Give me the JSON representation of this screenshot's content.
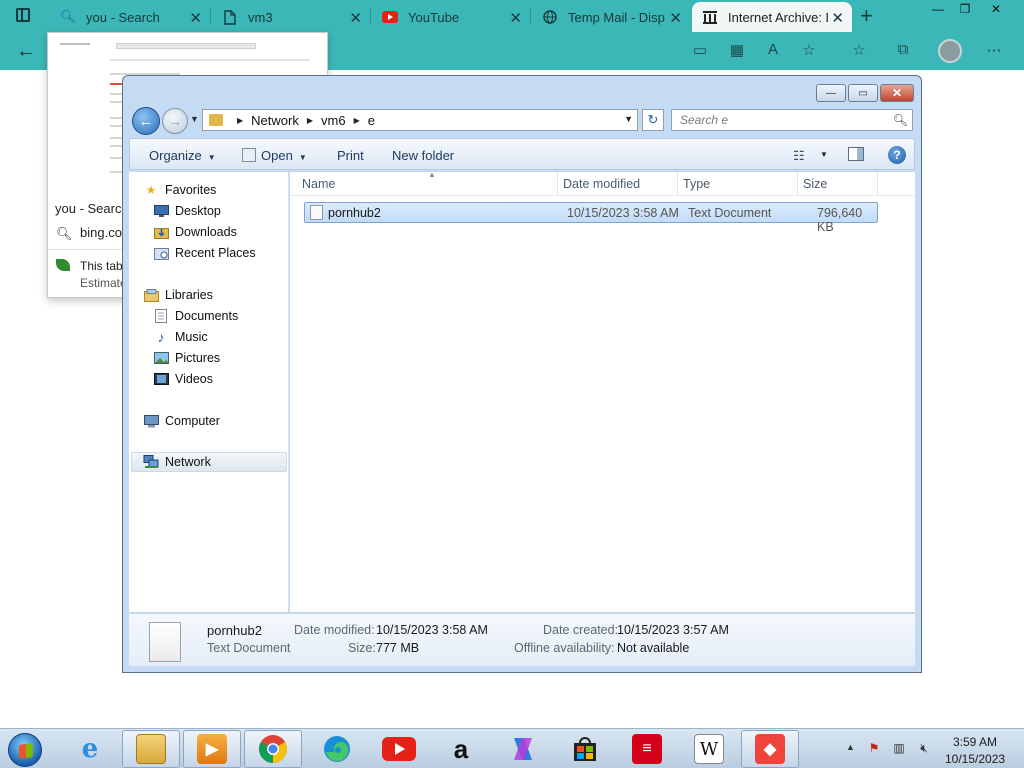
{
  "browser": {
    "tabs": [
      {
        "title": "you - Search",
        "icon": "search-icon"
      },
      {
        "title": "vm3",
        "icon": "page-icon"
      },
      {
        "title": "YouTube",
        "icon": "youtube-icon"
      },
      {
        "title": "Temp Mail - Disp",
        "icon": "globe-icon"
      },
      {
        "title": "Internet Archive: D",
        "icon": "archive-icon"
      }
    ],
    "hover_preview": {
      "title": "you - Search",
      "url": "bing.co",
      "note_line1": "This tab",
      "note_line2": "Estimate"
    }
  },
  "explorer": {
    "breadcrumb": [
      "Network",
      "vm6",
      "e"
    ],
    "search_placeholder": "Search e",
    "toolbar": {
      "organize": "Organize",
      "open": "Open",
      "print": "Print",
      "new_folder": "New folder"
    },
    "nav": {
      "favorites": "Favorites",
      "desktop": "Desktop",
      "downloads": "Downloads",
      "recent_places": "Recent Places",
      "libraries": "Libraries",
      "documents": "Documents",
      "music": "Music",
      "pictures": "Pictures",
      "videos": "Videos",
      "computer": "Computer",
      "network": "Network"
    },
    "columns": {
      "name": "Name",
      "date_modified": "Date modified",
      "type": "Type",
      "size": "Size"
    },
    "files": [
      {
        "name": "pornhub2",
        "date_modified": "10/15/2023 3:58 AM",
        "type": "Text Document",
        "size": "796,640 KB"
      }
    ],
    "details": {
      "name": "pornhub2",
      "type": "Text Document",
      "date_modified_label": "Date modified:",
      "date_modified": "10/15/2023 3:58 AM",
      "size_label": "Size:",
      "size": "777 MB",
      "date_created_label": "Date created:",
      "date_created": "10/15/2023 3:57 AM",
      "offline_label": "Offline availability:",
      "offline": "Not available"
    }
  },
  "taskbar": {
    "apps": [
      "internet-explorer",
      "file-explorer",
      "media-player",
      "chrome",
      "edge",
      "youtube",
      "amazon",
      "copilot",
      "store",
      "bank-of-america",
      "wikipedia",
      "anydesk"
    ],
    "clock_time": "3:59 AM",
    "clock_date": "10/15/2023"
  },
  "colors": {
    "browser_chrome": "#3cb7b7",
    "selection": "#c1dcf9",
    "window_frame": "#c4dbf3"
  }
}
